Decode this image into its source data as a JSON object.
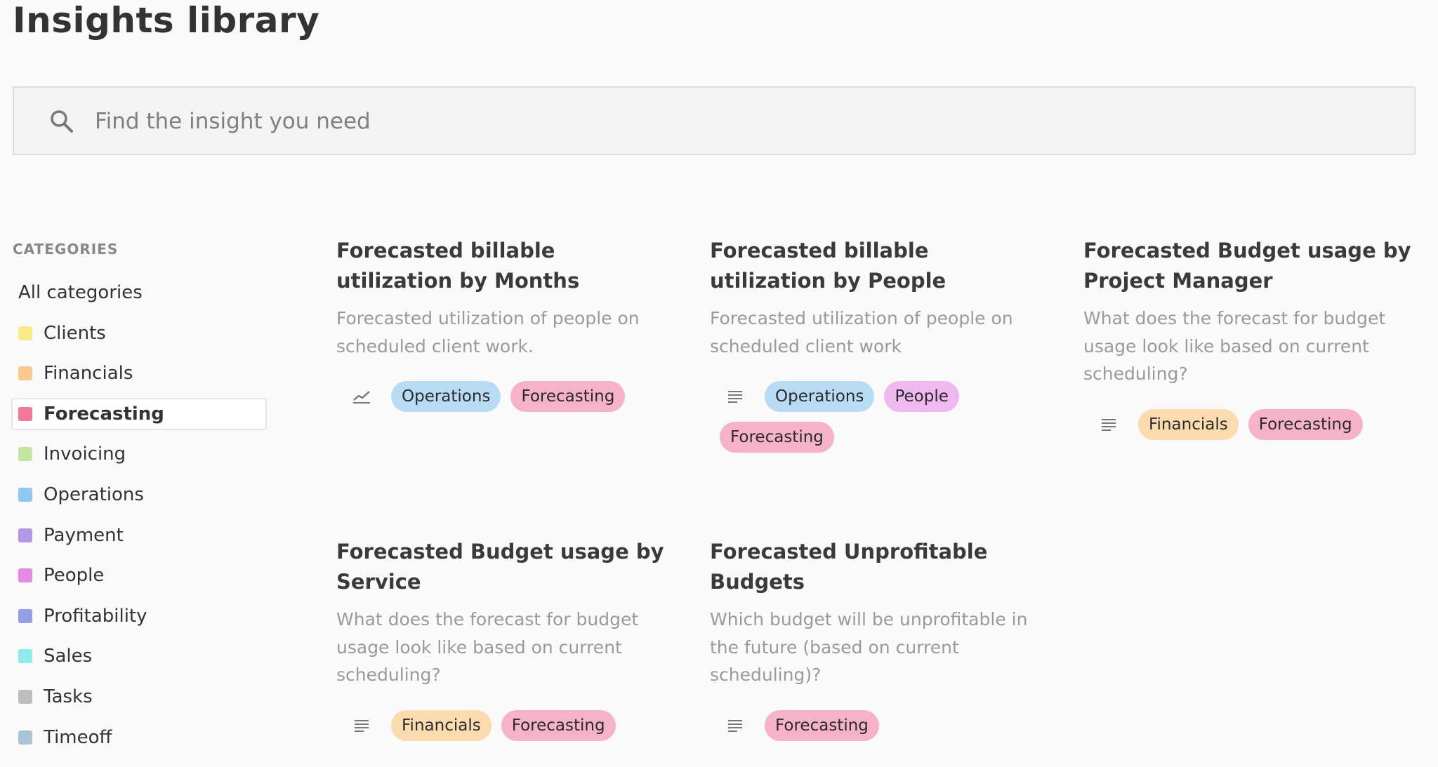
{
  "page": {
    "title": "Insights library"
  },
  "search": {
    "placeholder": "Find the insight you need",
    "value": ""
  },
  "categories": {
    "heading": "CATEGORIES",
    "all_label": "All categories",
    "items": [
      {
        "label": "Clients",
        "color": "#fbe98a"
      },
      {
        "label": "Financials",
        "color": "#f9c98d"
      },
      {
        "label": "Forecasting",
        "color": "#f2799a",
        "active": true
      },
      {
        "label": "Invoicing",
        "color": "#c3e5a0"
      },
      {
        "label": "Operations",
        "color": "#8ec9f3"
      },
      {
        "label": "Payment",
        "color": "#b49ae6"
      },
      {
        "label": "People",
        "color": "#e68ae8"
      },
      {
        "label": "Profitability",
        "color": "#969ee6"
      },
      {
        "label": "Sales",
        "color": "#8cecec"
      },
      {
        "label": "Tasks",
        "color": "#bdbdbd"
      },
      {
        "label": "Timeoff",
        "color": "#a9c4d6"
      }
    ]
  },
  "cards": [
    {
      "title": "Forecasted billable utilization by Months",
      "description": "Forecasted utilization of people on scheduled client work.",
      "type_icon": "line-chart-icon",
      "tags": [
        "Operations",
        "Forecasting"
      ]
    },
    {
      "title": "Forecasted billable utilization by People",
      "description": "Forecasted utilization of people on scheduled client work",
      "type_icon": "list-icon",
      "tags": [
        "Operations",
        "People",
        "Forecasting"
      ]
    },
    {
      "title": "Forecasted Budget usage by Project Manager",
      "description": "What does the forecast for budget usage look like based on current scheduling?",
      "type_icon": "list-icon",
      "tags": [
        "Financials",
        "Forecasting"
      ]
    },
    {
      "title": "Forecasted Budget usage by Service",
      "description": "What does the forecast for budget usage look like based on current scheduling?",
      "type_icon": "list-icon",
      "tags": [
        "Financials",
        "Forecasting"
      ]
    },
    {
      "title": "Forecasted Unprofitable Budgets",
      "description": "Which budget will be unprofitable in the future (based on current scheduling)?",
      "type_icon": "list-icon",
      "tags": [
        "Forecasting"
      ]
    }
  ],
  "tag_colors": {
    "Operations": "#b9dcf5",
    "Forecasting": "#f6b3c8",
    "Financials": "#fbdcae",
    "People": "#efb8ef"
  }
}
